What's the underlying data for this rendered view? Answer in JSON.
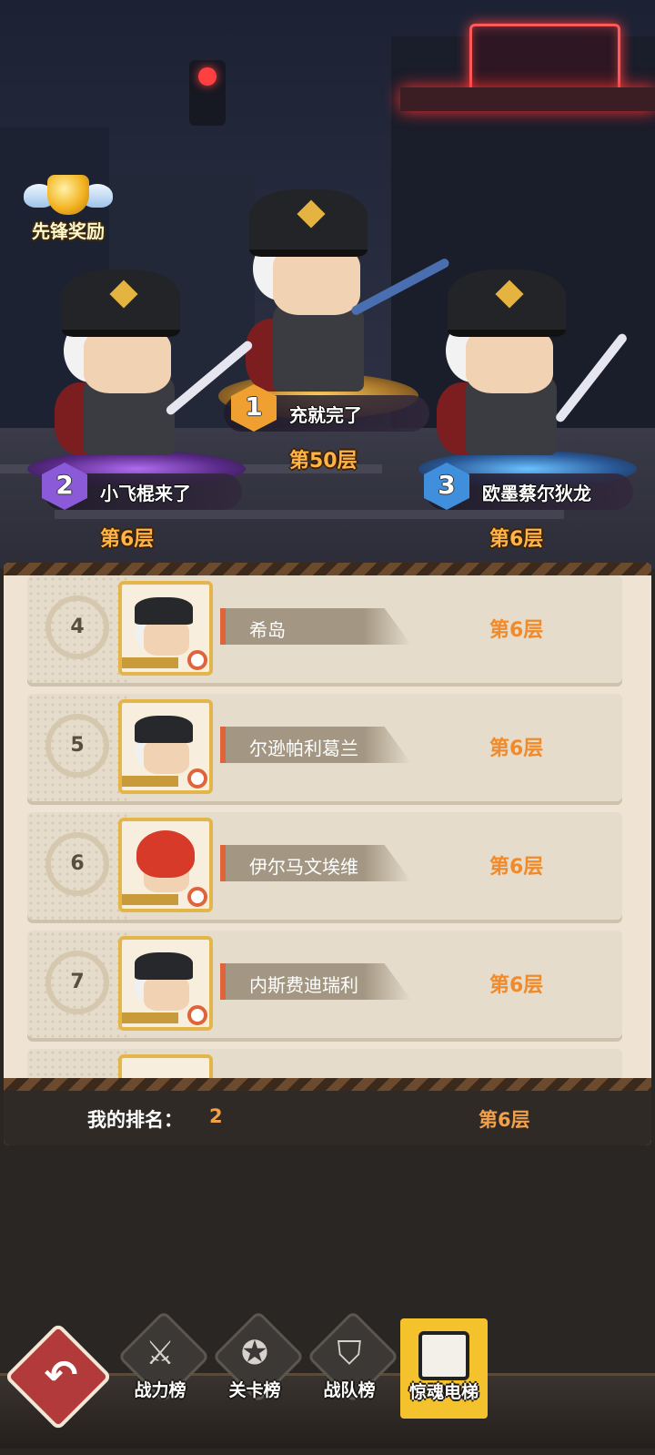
{
  "vanguard_reward": {
    "label": "先锋奖励"
  },
  "podium": [
    {
      "rank": "1",
      "name": "充就完了",
      "floor": "第50层",
      "badge_color": "#f0a030"
    },
    {
      "rank": "2",
      "name": "小飞棍来了",
      "floor": "第6层",
      "badge_color": "#8a5ad8"
    },
    {
      "rank": "3",
      "name": "欧墨蔡尔狄龙",
      "floor": "第6层",
      "badge_color": "#3f8fdc"
    }
  ],
  "list": [
    {
      "rank": "4",
      "name": "希岛",
      "floor": "第6层",
      "portrait": "officer"
    },
    {
      "rank": "5",
      "name": "尔逊帕利葛兰",
      "floor": "第6层",
      "portrait": "officer"
    },
    {
      "rank": "6",
      "name": "伊尔马文埃维",
      "floor": "第6层",
      "portrait": "red-hair"
    },
    {
      "rank": "7",
      "name": "内斯费迪瑞利",
      "floor": "第6层",
      "portrait": "officer"
    }
  ],
  "my_rank": {
    "label": "我的排名：",
    "value": "2",
    "floor": "第6层"
  },
  "tabs": [
    {
      "label": "战力榜",
      "icon": "crossed-swords-icon",
      "active": false
    },
    {
      "label": "关卡榜",
      "icon": "star-medal-icon",
      "active": false
    },
    {
      "label": "战队榜",
      "icon": "shield-chevron-icon",
      "active": false
    },
    {
      "label": "惊魂电梯",
      "icon": "elevator-ghost-icon",
      "active": true
    }
  ],
  "colors": {
    "accent_orange": "#f08a2a",
    "gold": "#f4c22c",
    "back_red": "#b23a3a"
  }
}
